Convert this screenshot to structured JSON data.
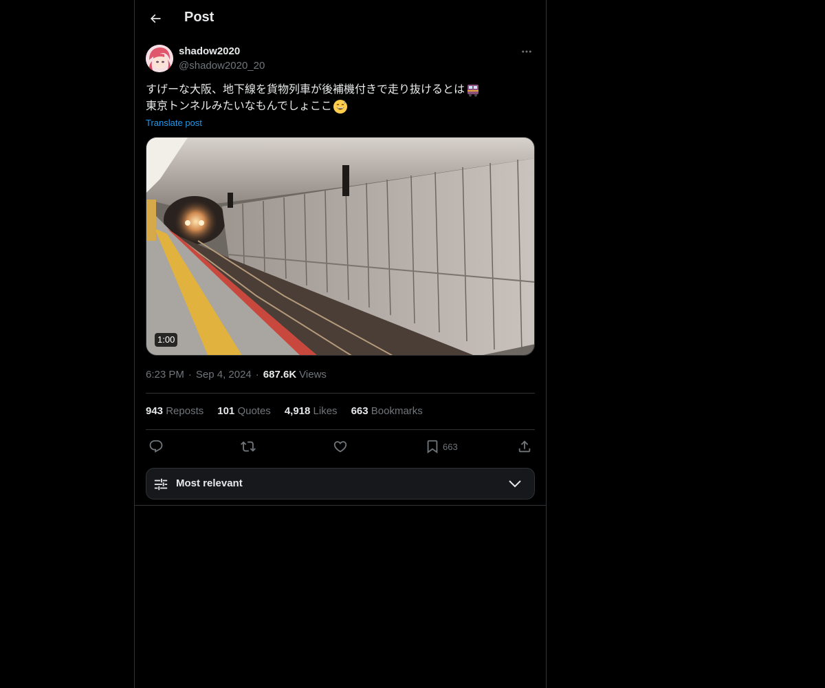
{
  "header": {
    "title": "Post"
  },
  "author": {
    "display_name": "shadow2020",
    "handle": "@shadow2020_20"
  },
  "post": {
    "line1": "すげーな大阪、地下線を貨物列車が後補機付きで走り抜けるとは",
    "line2": "東京トンネルみたいなもんでしょここ",
    "line1_emoji": "train-emoji",
    "line2_emoji": "sweat-smile-emoji",
    "translate_label": "Translate post"
  },
  "media": {
    "type": "video",
    "duration": "1:00"
  },
  "meta": {
    "time": "6:23 PM",
    "separator": "·",
    "date": "Sep 4, 2024",
    "views_count": "687.6K",
    "views_label": "Views"
  },
  "stats": [
    {
      "count": "943",
      "label": "Reposts"
    },
    {
      "count": "101",
      "label": "Quotes"
    },
    {
      "count": "4,918",
      "label": "Likes"
    },
    {
      "count": "663",
      "label": "Bookmarks"
    }
  ],
  "actions": {
    "reply": "reply-icon",
    "repost": "repost-icon",
    "like": "heart-icon",
    "bookmark": "bookmark-icon",
    "bookmark_count": "663",
    "share": "share-icon"
  },
  "filter": {
    "label": "Most relevant",
    "icon": "sliders-icon"
  },
  "colors": {
    "background": "#000000",
    "text": "#e7e9ea",
    "secondary": "#71767b",
    "accent": "#1d9bf0",
    "border": "#2f3336"
  }
}
